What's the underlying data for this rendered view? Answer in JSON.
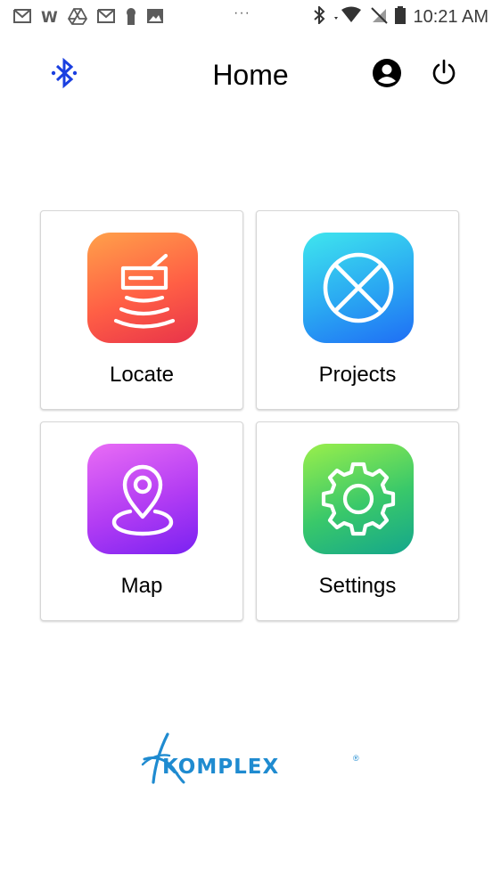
{
  "status_bar": {
    "time": "10:21 AM",
    "overflow": "···",
    "left_icons": [
      "gmail-icon",
      "w-icon",
      "drive-icon",
      "gmail-icon",
      "keyhole-icon",
      "image-icon"
    ],
    "right_icons": [
      "bluetooth-icon",
      "wifi-icon",
      "no-sim-icon",
      "battery-icon"
    ]
  },
  "app_bar": {
    "title": "Home",
    "left_icon": "bluetooth-icon",
    "right_icons": [
      "account-icon",
      "power-icon"
    ]
  },
  "tiles": [
    {
      "label": "Locate",
      "icon": "locator-icon",
      "gradient": [
        "#ffa14a",
        "#e8334a"
      ]
    },
    {
      "label": "Projects",
      "icon": "projects-icon",
      "gradient": [
        "#3fe6ee",
        "#1f6ef5"
      ]
    },
    {
      "label": "Map",
      "icon": "map-pin-icon",
      "gradient": [
        "#e96cf5",
        "#7a22f2"
      ]
    },
    {
      "label": "Settings",
      "icon": "gear-icon",
      "gradient": [
        "#9aef4b",
        "#14a68c"
      ]
    }
  ],
  "brand": {
    "name": "KOMPLEX",
    "registered": "®",
    "color": "#1f8bd0"
  },
  "colors": {
    "accent_bluetooth": "#1a3fe0",
    "tile_border": "#d6d6d6"
  }
}
